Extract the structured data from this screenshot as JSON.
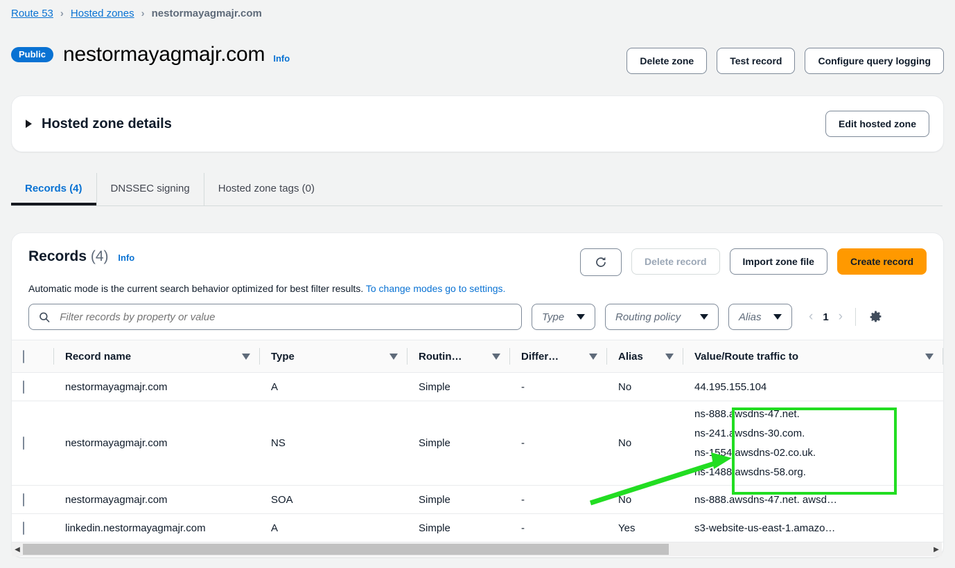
{
  "breadcrumb": {
    "items": [
      {
        "label": "Route 53",
        "link": true
      },
      {
        "label": "Hosted zones",
        "link": true
      },
      {
        "label": "nestormayagmajr.com",
        "link": false
      }
    ],
    "separator": "›"
  },
  "header": {
    "badge": "Public",
    "title": "nestormayagmajr.com",
    "info_label": "Info",
    "actions": [
      {
        "label": "Delete zone",
        "name": "delete-zone-button"
      },
      {
        "label": "Test record",
        "name": "test-record-button"
      },
      {
        "label": "Configure query logging",
        "name": "configure-query-logging-button"
      }
    ]
  },
  "details": {
    "title": "Hosted zone details",
    "edit_label": "Edit hosted zone",
    "expanded": false
  },
  "tabs": [
    {
      "label": "Records (4)",
      "active": true
    },
    {
      "label": "DNSSEC signing",
      "active": false
    },
    {
      "label": "Hosted zone tags (0)",
      "active": false
    }
  ],
  "records": {
    "title": "Records",
    "count": "(4)",
    "info_label": "Info",
    "description": "Automatic mode is the current search behavior optimized for best filter results.",
    "description_link": "To change modes go to settings.",
    "buttons": {
      "refresh_icon": "refresh-icon",
      "delete_record": "Delete record",
      "delete_record_disabled": true,
      "import_zone_file": "Import zone file",
      "create_record": "Create record"
    },
    "filter": {
      "placeholder": "Filter records by property or value",
      "value": "",
      "search_icon": "search-icon"
    },
    "selects": [
      {
        "label": "Type",
        "name": "type-filter-select"
      },
      {
        "label": "Routing policy",
        "name": "routing-policy-filter-select"
      },
      {
        "label": "Alias",
        "name": "alias-filter-select"
      }
    ],
    "pagination": {
      "prev": "‹",
      "page": "1",
      "next": "›"
    },
    "settings_icon": "gear-icon",
    "columns": [
      "Record name",
      "Type",
      "Routin…",
      "Differ…",
      "Alias",
      "Value/Route traffic to"
    ],
    "rows": [
      {
        "record_name": "nestormayagmajr.com",
        "type": "A",
        "routing_policy": "Simple",
        "differentiator": "-",
        "alias": "No",
        "value": "44.195.155.104",
        "value_lines": [],
        "tall": false,
        "highlighted": false
      },
      {
        "record_name": "nestormayagmajr.com",
        "type": "NS",
        "routing_policy": "Simple",
        "differentiator": "-",
        "alias": "No",
        "value": "",
        "value_lines": [
          "ns-888.awsdns-47.net.",
          "ns-241.awsdns-30.com.",
          "ns-1554.awsdns-02.co.uk.",
          "ns-1488.awsdns-58.org."
        ],
        "tall": true,
        "highlighted": true
      },
      {
        "record_name": "nestormayagmajr.com",
        "type": "SOA",
        "routing_policy": "Simple",
        "differentiator": "-",
        "alias": "No",
        "value": "ns-888.awsdns-47.net. awsd…",
        "value_lines": [],
        "tall": false,
        "highlighted": false
      },
      {
        "record_name": "linkedin.nestormayagmajr.com",
        "type": "A",
        "routing_policy": "Simple",
        "differentiator": "-",
        "alias": "Yes",
        "value": "s3-website-us-east-1.amazo…",
        "value_lines": [],
        "tall": false,
        "highlighted": false
      }
    ]
  },
  "annotation": {
    "color": "#22dd22",
    "target": "ns-record-value-cell"
  },
  "scrollbar": {
    "left_arrow": "◀",
    "right_arrow": "▶"
  },
  "colors": {
    "accent_link": "#0972d3",
    "primary_button": "#ff9900",
    "badge": "#0972d3",
    "annotation": "#22dd22"
  }
}
